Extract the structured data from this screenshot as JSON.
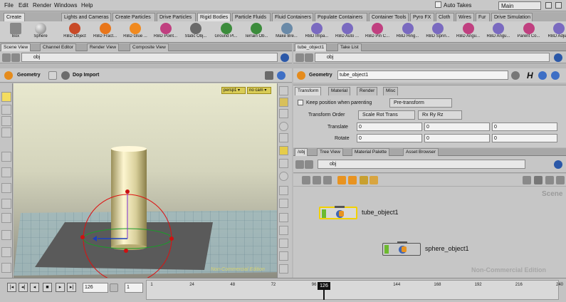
{
  "menu": {
    "items": [
      "File",
      "Edit",
      "Render",
      "Windows",
      "Help"
    ],
    "auto_takes": "Auto Takes",
    "main": "Main"
  },
  "shelf_tabs": [
    "Create",
    "Lights and Cameras",
    "Create Particles",
    "Drive Particles",
    "Rigid Bodies",
    "Particle Fluids",
    "Fluid Containers",
    "Populate Containers",
    "Container Tools",
    "Pyro FX",
    "Cloth",
    "Wires",
    "Fur",
    "Drive Simulation"
  ],
  "create_tools": [
    "Box",
    "Sphere"
  ],
  "rbd_tools": [
    "RBD Object",
    "RBD Fract...",
    "RBD Glue ...",
    "RBD Point...",
    "Static Obj...",
    "Ground Pl...",
    "Terrain Ob...",
    "Make Bre...",
    "RBD Impa...",
    "RBD Auto ...",
    "RBD Pin C...",
    "RBD Hing...",
    "RBD Sprin...",
    "RBD Angu...",
    "RBD Angu...",
    "Parent Co...",
    "RBD Adju..."
  ],
  "left_pane": {
    "tabs": [
      "Scene View",
      "Channel Editor",
      "Render View",
      "Composite View"
    ],
    "path": "obj",
    "context": "Geometry",
    "dop_import": "Dop Import",
    "persp": "persp1 ▾",
    "cam": "no cam ▾",
    "watermark": "Non-Commercial Edition"
  },
  "param_pane": {
    "tabs": [
      "tube_object1",
      "Take List"
    ],
    "context": "Geometry",
    "node_name": "tube_object1",
    "subtabs": [
      "Transform",
      "Material",
      "Render",
      "Misc"
    ],
    "keep_position_label": "Keep position when parenting",
    "keep_position_value": "Pre-transform",
    "transform_order_label": "Transform Order",
    "transform_order_value": "Scale Rot Trans",
    "rotate_order_value": "Rx Ry Rz",
    "translate_label": "Translate",
    "translate": [
      "0",
      "0",
      "0"
    ],
    "rotate_label": "Rotate",
    "rotate": [
      "0",
      "0",
      "0"
    ]
  },
  "network_pane": {
    "tabs": [
      "/obj",
      "Tree View",
      "Material Palette",
      "Asset Browser"
    ],
    "path": "obj",
    "scene_label": "Scene",
    "watermark": "Non-Commercial Edition",
    "nodes": [
      {
        "name": "tube_object1"
      },
      {
        "name": "sphere_object1"
      }
    ]
  },
  "timeline": {
    "current_frame": "126",
    "step": "1",
    "ticks": [
      "1",
      "24",
      "48",
      "72",
      "96",
      "126",
      "144",
      "168",
      "192",
      "216",
      "240"
    ],
    "end_frame": "240"
  },
  "colors": {
    "accent": "#e8e8ce",
    "node_green": "#6dba2f",
    "selected": "#f2d100"
  }
}
